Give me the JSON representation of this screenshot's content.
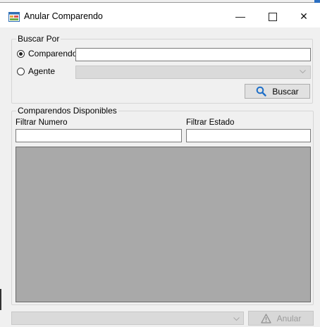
{
  "window": {
    "title": "Anular Comparendo",
    "controls": {
      "minimize": "—",
      "maximize": "",
      "close": "✕"
    }
  },
  "search_group": {
    "legend": "Buscar Por",
    "radio_comparendo": {
      "label": "Comparendo",
      "checked": true
    },
    "radio_agente": {
      "label": "Agente",
      "checked": false
    },
    "comparendo_value": "",
    "agente_value": "",
    "search_button": "Buscar"
  },
  "available_group": {
    "legend": "Comparendos Disponibles",
    "filter_number_label": "Filtrar Numero",
    "filter_number_value": "",
    "filter_state_label": "Filtrar Estado",
    "filter_state_value": ""
  },
  "footer": {
    "reason_value": "",
    "annul_button": "Anular"
  },
  "icons": {
    "app": "form-icon",
    "search": "magnifier-icon",
    "annul": "warning-triangle-icon",
    "combo": "chevron-down-icon"
  },
  "colors": {
    "title_bar": "#ffffff",
    "window_bg": "#f0f0f0",
    "grid_bg": "#a9a9a9",
    "search_icon": "#1e6fc8"
  }
}
